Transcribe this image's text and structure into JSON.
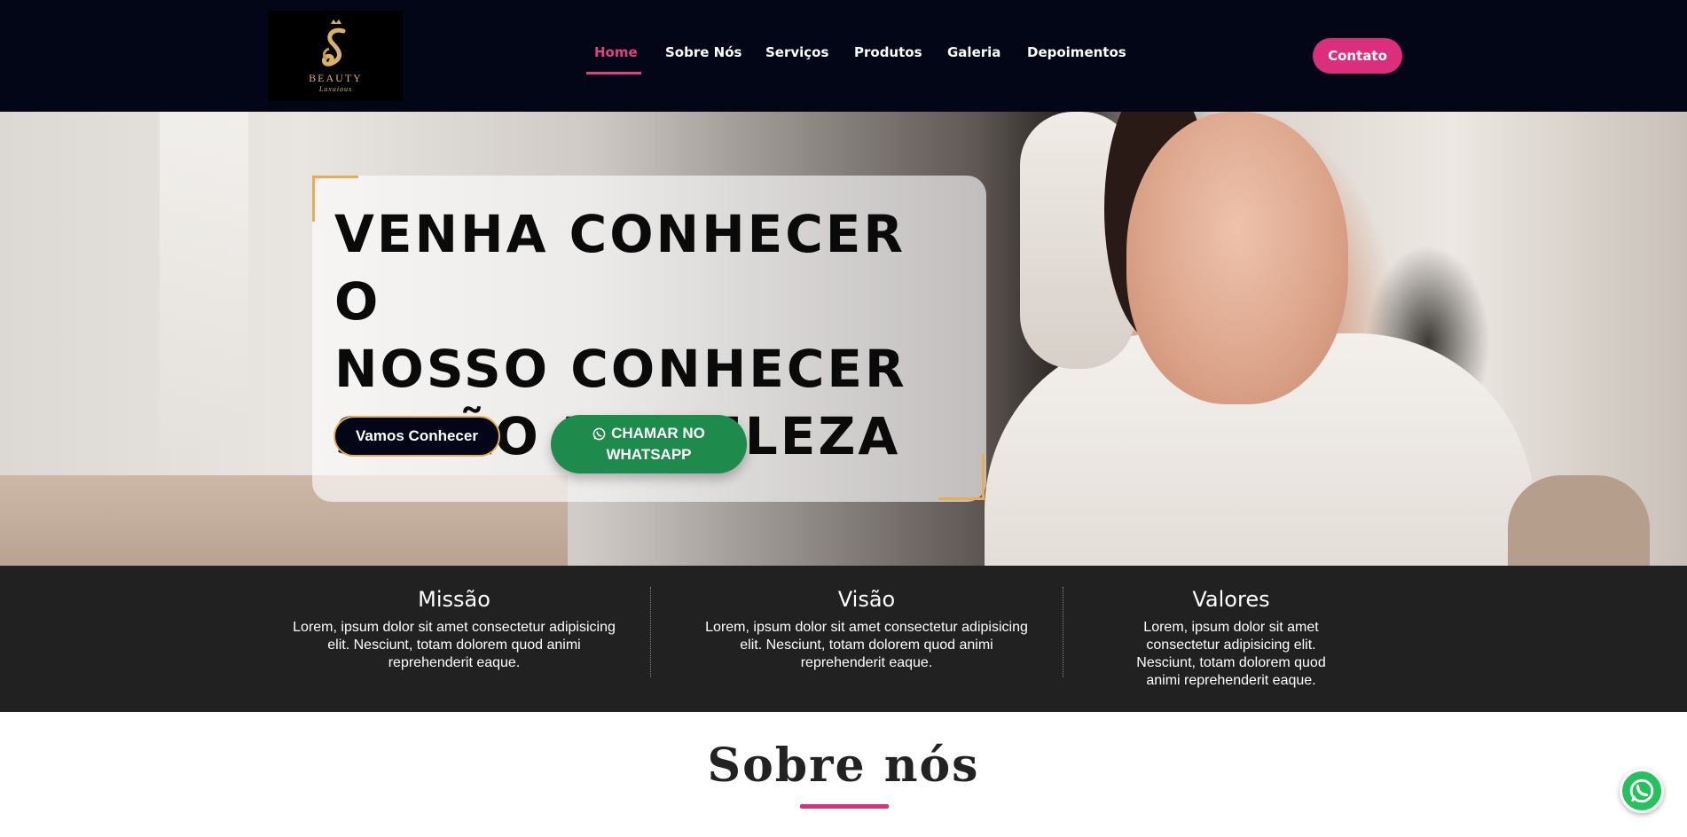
{
  "header": {
    "logo": {
      "brand": "BEAUTY",
      "sub": "Luxuious"
    },
    "nav": [
      {
        "label": "Home",
        "active": true
      },
      {
        "label": "Sobre Nós",
        "active": false
      },
      {
        "label": "Serviços",
        "active": false
      },
      {
        "label": "Produtos",
        "active": false
      },
      {
        "label": "Galeria",
        "active": false
      },
      {
        "label": "Depoimentos",
        "active": false
      }
    ],
    "contact_label": "Contato"
  },
  "hero": {
    "title_lines": [
      "VENHA CONHECER O",
      "NOSSO CONHECER",
      "SALÃO DE BELEZA"
    ],
    "primary_button": "Vamos Conhecer",
    "whatsapp_button": {
      "line1": "CHAMAR NO",
      "line2": "WHATSAPP",
      "icon": "whatsapp-icon"
    }
  },
  "values": [
    {
      "title": "Missão",
      "text": "Lorem, ipsum dolor sit amet consectetur adipisicing elit. Nesciunt, totam dolorem quod animi reprehenderit eaque."
    },
    {
      "title": "Visão",
      "text": "Lorem, ipsum dolor sit amet consectetur adipisicing elit. Nesciunt, totam dolorem quod animi reprehenderit eaque."
    },
    {
      "title": "Valores",
      "text": "Lorem, ipsum dolor sit amet consectetur adipisicing elit. Nesciunt, totam dolorem quod animi reprehenderit eaque."
    }
  ],
  "about": {
    "title": "Sobre nós"
  },
  "floating": {
    "icon": "whatsapp-icon"
  },
  "colors": {
    "accent": "#db2f7e",
    "nav_bg": "#020617",
    "gold": "#e4ae55",
    "whatsapp": "#1e8a4b",
    "band": "#212121"
  }
}
